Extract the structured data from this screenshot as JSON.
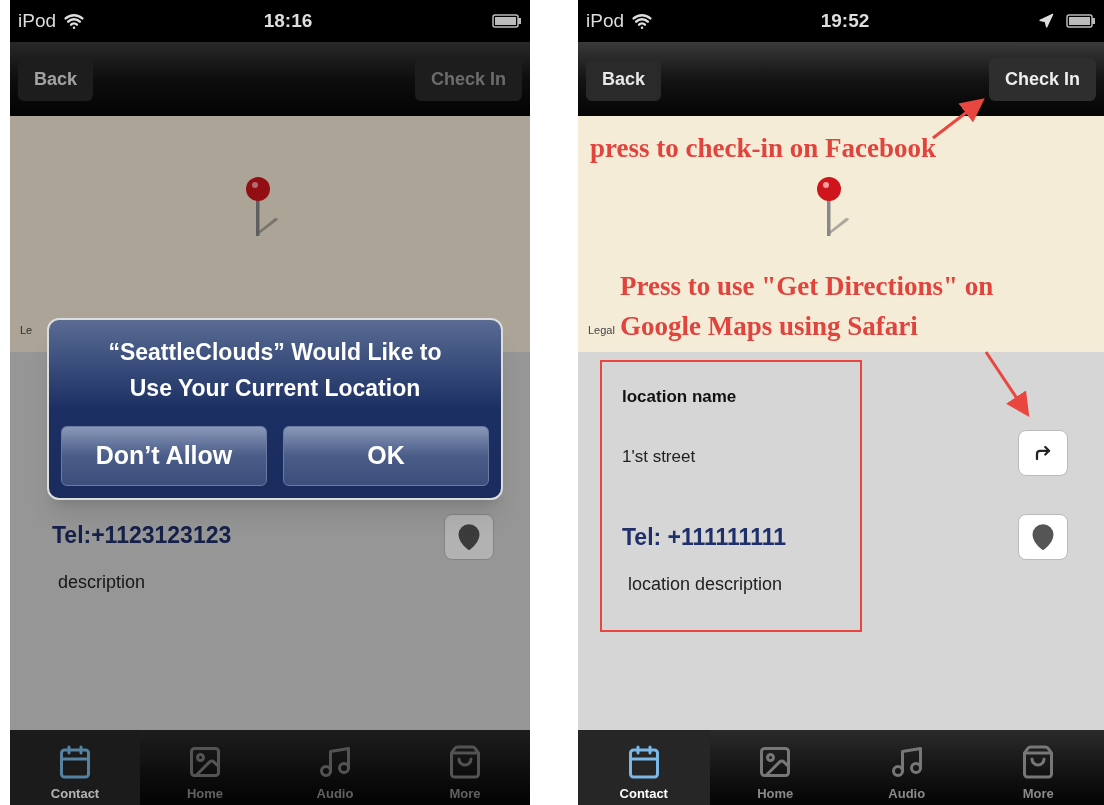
{
  "screens": [
    {
      "status_bar": {
        "carrier": "iPod",
        "time": "18:16",
        "location_services": false
      },
      "nav_bar": {
        "back": "Back",
        "action": {
          "label": "Check In",
          "disabled": true
        }
      },
      "map": {
        "legal": "Le"
      },
      "details": {
        "tel": "Tel:+1123123123",
        "description": "description",
        "highlighted": false
      },
      "alert": {
        "message": "“SeattleClouds” Would Like to Use Your Current Location",
        "buttons": [
          "Don’t Allow",
          "OK"
        ]
      },
      "tabs": [
        {
          "label": "Contact",
          "selected": true
        },
        {
          "label": "Home",
          "selected": false
        },
        {
          "label": "Audio",
          "selected": false
        },
        {
          "label": "More",
          "selected": false
        }
      ]
    },
    {
      "status_bar": {
        "carrier": "iPod",
        "time": "19:52",
        "location_services": true
      },
      "nav_bar": {
        "back": "Back",
        "action": {
          "label": "Check In",
          "disabled": false
        }
      },
      "map": {
        "legal": "Legal"
      },
      "details": {
        "name": "location name",
        "street": "1'st street",
        "tel": "Tel: +111111111",
        "description": "location description",
        "highlighted": true
      },
      "annotations": [
        {
          "text": "press to check-in on Facebook"
        },
        {
          "text": "Press to use \"Get Directions\" on Google Maps using Safari"
        }
      ],
      "tabs": [
        {
          "label": "Contact",
          "selected": true
        },
        {
          "label": "Home",
          "selected": false
        },
        {
          "label": "Audio",
          "selected": false
        },
        {
          "label": "More",
          "selected": false
        }
      ]
    }
  ]
}
